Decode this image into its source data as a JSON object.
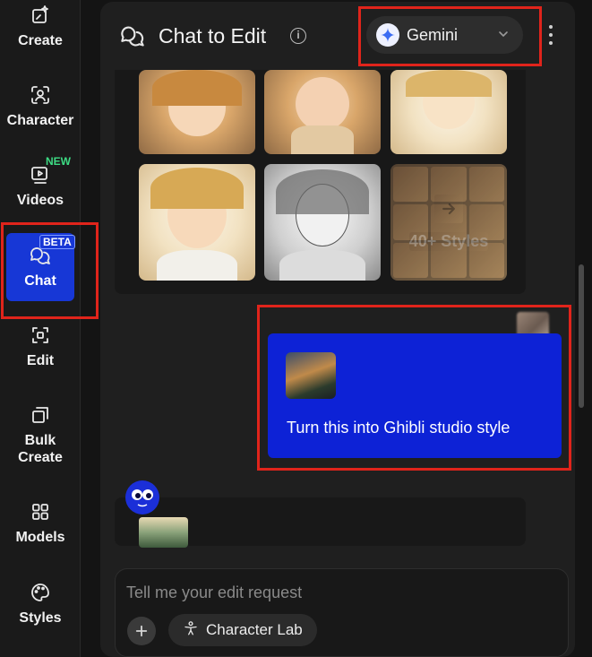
{
  "sidebar": {
    "items": [
      {
        "label": "Create",
        "icon": "sparkle-edit-icon"
      },
      {
        "label": "Character",
        "icon": "face-scan-icon"
      },
      {
        "label": "Videos",
        "icon": "video-icon",
        "badge": "NEW"
      },
      {
        "label": "Chat",
        "icon": "chat-bubbles-icon",
        "badge": "BETA",
        "active": true
      },
      {
        "label": "Edit",
        "icon": "crop-edit-icon"
      },
      {
        "label": "Bulk\nCreate",
        "icon": "layers-icon"
      },
      {
        "label": "Models",
        "icon": "grid-icon"
      },
      {
        "label": "Styles",
        "icon": "palette-icon"
      }
    ]
  },
  "header": {
    "title": "Chat to Edit",
    "info": "i",
    "model": "Gemini"
  },
  "gallery": {
    "more_label": "40+ Styles"
  },
  "messages": {
    "user_text": "Turn this into Ghibli studio style"
  },
  "input": {
    "placeholder": "Tell me your edit request",
    "character_lab": "Character Lab"
  },
  "colors": {
    "accent": "#1737d6",
    "highlight": "#e0241b",
    "new_badge": "#3ddc84"
  }
}
